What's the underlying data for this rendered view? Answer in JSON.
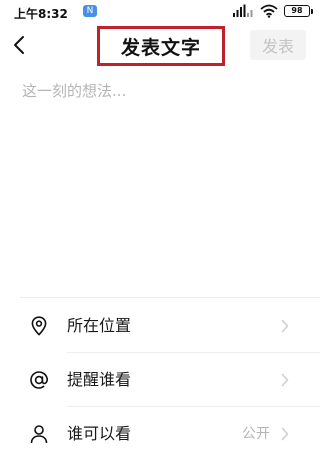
{
  "status_bar": {
    "time": "上午8:32",
    "badge": "N",
    "battery": "98"
  },
  "header": {
    "title": "发表文字",
    "publish_label": "发表"
  },
  "compose": {
    "placeholder": "这一刻的想法..."
  },
  "options": [
    {
      "label": "所在位置",
      "icon": "location-pin-icon"
    },
    {
      "label": "提醒谁看",
      "icon": "at-sign-icon"
    },
    {
      "label": "谁可以看",
      "value": "公开",
      "icon": "person-icon"
    }
  ],
  "colors": {
    "highlight_border": "#c0222c",
    "publish_disabled_bg": "#f3f3f3",
    "publish_disabled_text": "#c4c4c4",
    "placeholder": "#b5b5b5"
  }
}
